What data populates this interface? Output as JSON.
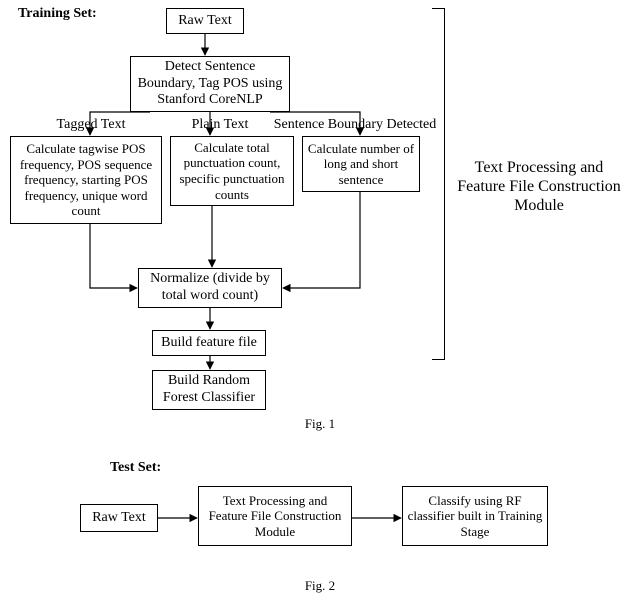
{
  "fig1": {
    "title": "Training Set:",
    "boxes": {
      "raw_text": "Raw Text",
      "detect": "Detect Sentence Boundary, Tag POS using Stanford CoreNLP",
      "calc_left": "Calculate tagwise POS frequency, POS sequence frequency, starting POS frequency, unique word count",
      "calc_mid": "Calculate total punctuation count, specific punctuation counts",
      "calc_right": "Calculate number of long and short sentence",
      "normalize": "Normalize (divide by total word count)",
      "build_feature": "Build feature file",
      "build_rf": "Build Random Forest Classifier"
    },
    "edge_labels": {
      "tagged": "Tagged Text",
      "plain": "Plain Text",
      "boundary": "Sentence Boundary Detected"
    },
    "bracket_label": "Text Processing and Feature File Construction Module",
    "caption": "Fig. 1"
  },
  "fig2": {
    "title": "Test Set:",
    "boxes": {
      "raw_text": "Raw Text",
      "module": "Text Processing and Feature File Construction Module",
      "classify": "Classify using RF classifier built in Training Stage"
    },
    "caption": "Fig. 2"
  }
}
